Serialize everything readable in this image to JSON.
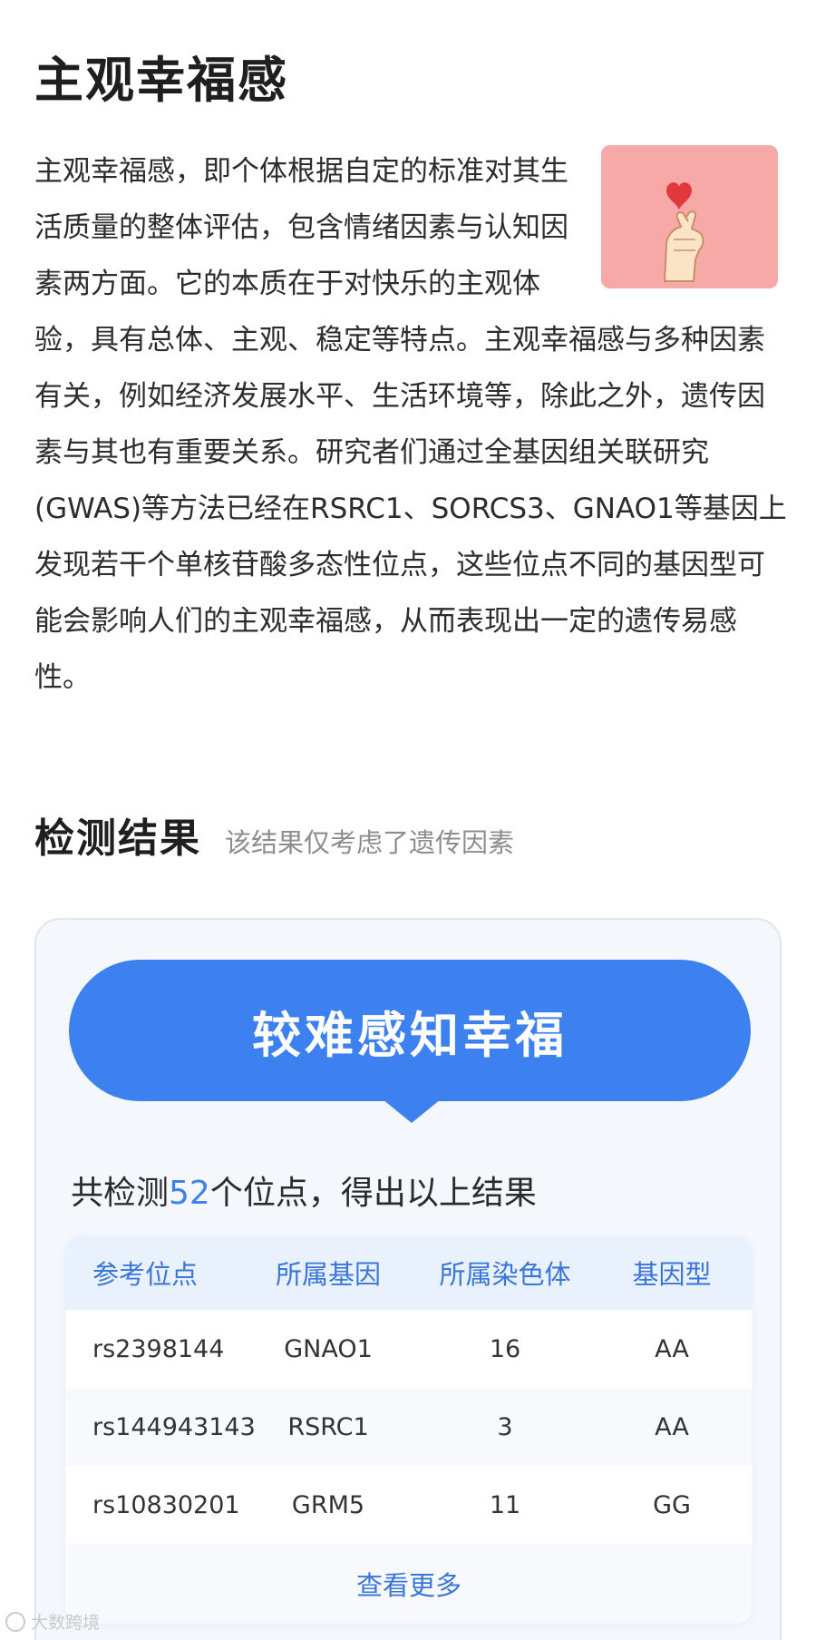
{
  "article": {
    "title": "主观幸福感",
    "intro": "主观幸福感，即个体根据自定的标准对其生活质量的整体评估，包含情绪因素与认知因素两方面。它的本质在于对快乐的主观体验，具有总体、主观、稳定等特点。主观幸福感与多种因素有关，例如经济发展水平、生活环境等，除此之外，遗传因素与其也有重要关系。研究者们通过全基因组关联研究(GWAS)等方法已经在RSRC1、SORCS3、GNAO1等基因上发现若干个单核苷酸多态性位点，这些位点不同的基因型可能会影响人们的主观幸福感，从而表现出一定的遗传易感性。",
    "image_icon": "finger-heart-icon"
  },
  "results": {
    "title": "检测结果",
    "subtitle": "该结果仅考虑了遗传因素",
    "banner": "较难感知幸福",
    "count_prefix": "共检测",
    "count_value": "52",
    "count_suffix": "个位点，得出以上结果",
    "table": {
      "headers": [
        "参考位点",
        "所属基因",
        "所属染色体",
        "基因型"
      ],
      "rows": [
        [
          "rs2398144",
          "GNAO1",
          "16",
          "AA"
        ],
        [
          "rs144943143",
          "RSRC1",
          "3",
          "AA"
        ],
        [
          "rs10830201",
          "GRM5",
          "11",
          "GG"
        ]
      ]
    },
    "more_label": "查看更多"
  },
  "colors": {
    "accent": "#3d80ef",
    "card_bg": "#f4f8fd",
    "header_bg": "#e9f1fd",
    "image_bg": "#f7a9a7"
  },
  "watermark": {
    "text": "大数跨境"
  }
}
